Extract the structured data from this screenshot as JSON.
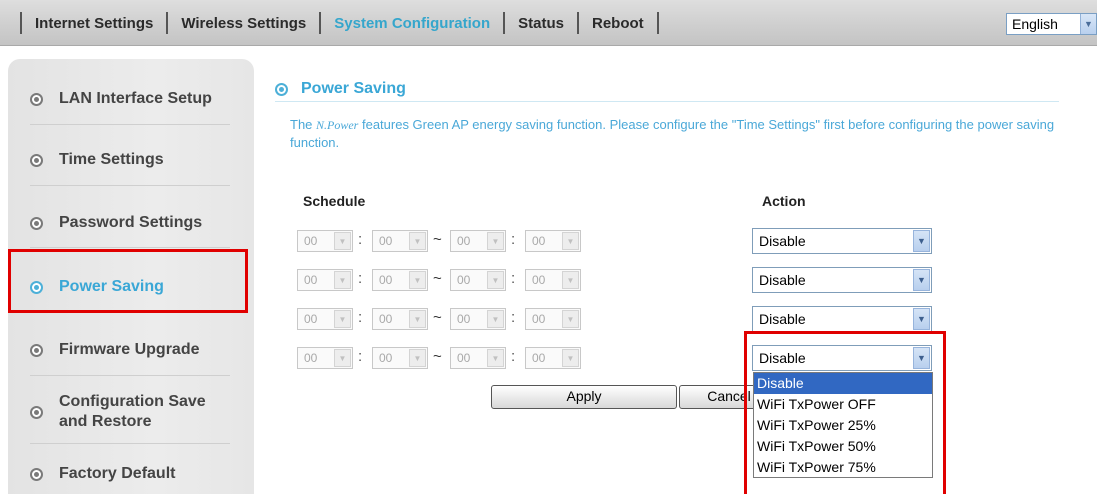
{
  "nav": {
    "items": [
      {
        "label": "Internet Settings",
        "active": false
      },
      {
        "label": "Wireless Settings",
        "active": false
      },
      {
        "label": "System Configuration",
        "active": true
      },
      {
        "label": "Status",
        "active": false
      },
      {
        "label": "Reboot",
        "active": false
      }
    ],
    "language": "English"
  },
  "sidebar": {
    "items": [
      {
        "label": "LAN Interface Setup",
        "active": false
      },
      {
        "label": "Time Settings",
        "active": false
      },
      {
        "label": "Password Settings",
        "active": false
      },
      {
        "label": "Power Saving",
        "active": true
      },
      {
        "label": "Firmware Upgrade",
        "active": false
      },
      {
        "label": "Configuration Save and Restore",
        "active": false
      },
      {
        "label": "Factory Default",
        "active": false
      }
    ]
  },
  "page": {
    "title": "Power Saving",
    "desc_prefix": "The ",
    "desc_brand": "N.Power",
    "desc_rest": " features Green AP energy saving function. Please configure the \"Time Settings\" first before configuring the power saving function."
  },
  "schedule": {
    "schedule_label": "Schedule",
    "action_label": "Action",
    "separator": "~",
    "colon": ":",
    "rows": [
      {
        "start_hour": "00",
        "start_min": "00",
        "end_hour": "00",
        "end_min": "00",
        "action": "Disable"
      },
      {
        "start_hour": "00",
        "start_min": "00",
        "end_hour": "00",
        "end_min": "00",
        "action": "Disable"
      },
      {
        "start_hour": "00",
        "start_min": "00",
        "end_hour": "00",
        "end_min": "00",
        "action": "Disable"
      },
      {
        "start_hour": "00",
        "start_min": "00",
        "end_hour": "00",
        "end_min": "00",
        "action": "Disable"
      }
    ]
  },
  "action_dropdown": {
    "options": [
      "Disable",
      "WiFi TxPower OFF",
      "WiFi TxPower 25%",
      "WiFi TxPower 50%",
      "WiFi TxPower 75%"
    ],
    "selected": "Disable"
  },
  "buttons": {
    "apply": "Apply",
    "cancel": "Cancel"
  },
  "colors": {
    "accent": "#3aa7d6",
    "highlight": "#e00000",
    "selection": "#3168c2"
  }
}
